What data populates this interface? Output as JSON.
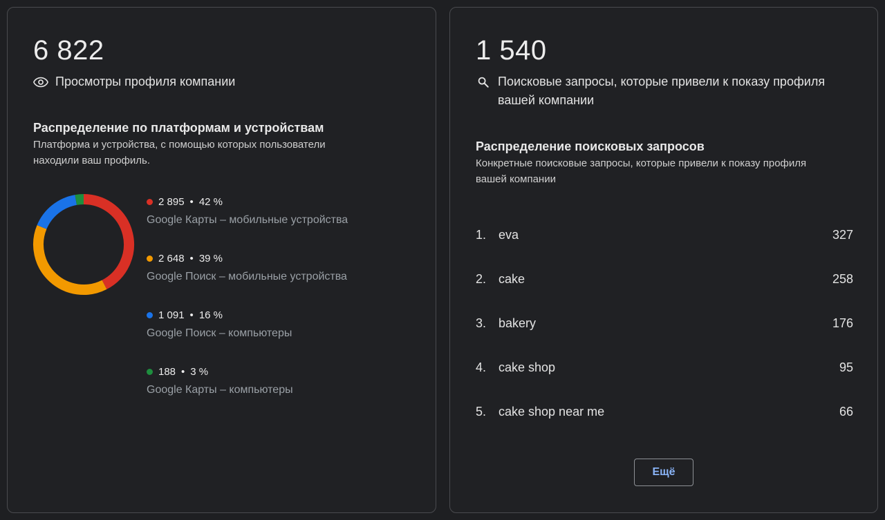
{
  "profile_views": {
    "total": "6 822",
    "label": "Просмотры профиля компании",
    "icon": "eye-icon"
  },
  "platform_breakdown": {
    "title": "Распределение по платформам и устройствам",
    "subtitle_line1": "Платформа и устройства, с помощью которых пользователи",
    "subtitle_line2": "находили ваш профиль.",
    "items": [
      {
        "count": "2 895",
        "percent": "42 %",
        "label": "Google Карты – мобильные устройства",
        "color": "#d93025"
      },
      {
        "count": "2 648",
        "percent": "39 %",
        "label": "Google Поиск – мобильные устройства",
        "color": "#f29900"
      },
      {
        "count": "1 091",
        "percent": "16 %",
        "label": "Google Поиск – компьютеры",
        "color": "#1a73e8"
      },
      {
        "count": "188",
        "percent": "3 %",
        "label": "Google Карты – компьютеры",
        "color": "#1e8e3e"
      }
    ]
  },
  "chart_data": {
    "type": "pie",
    "categories": [
      "Google Карты – мобильные устройства",
      "Google Поиск – мобильные устройства",
      "Google Поиск – компьютеры",
      "Google Карты – компьютеры"
    ],
    "values": [
      2895,
      2648,
      1091,
      188
    ],
    "colors": [
      "#d93025",
      "#f29900",
      "#1a73e8",
      "#1e8e3e"
    ]
  },
  "search_queries": {
    "total": "1 540",
    "label_line1": "Поисковые запросы, которые привели к показу профиля",
    "label_line2": "вашей компании",
    "icon": "search-icon"
  },
  "query_breakdown": {
    "title": "Распределение поисковых запросов",
    "subtitle_line1": "Конкретные поисковые запросы, которые привели к показу профиля",
    "subtitle_line2": "вашей компании",
    "rows": [
      {
        "rank": "1.",
        "term": "eva",
        "count": "327"
      },
      {
        "rank": "2.",
        "term": "cake",
        "count": "258"
      },
      {
        "rank": "3.",
        "term": "bakery",
        "count": "176"
      },
      {
        "rank": "4.",
        "term": "cake shop",
        "count": "95"
      },
      {
        "rank": "5.",
        "term": "cake shop near me",
        "count": "66"
      }
    ],
    "more_label": "Ещё"
  }
}
